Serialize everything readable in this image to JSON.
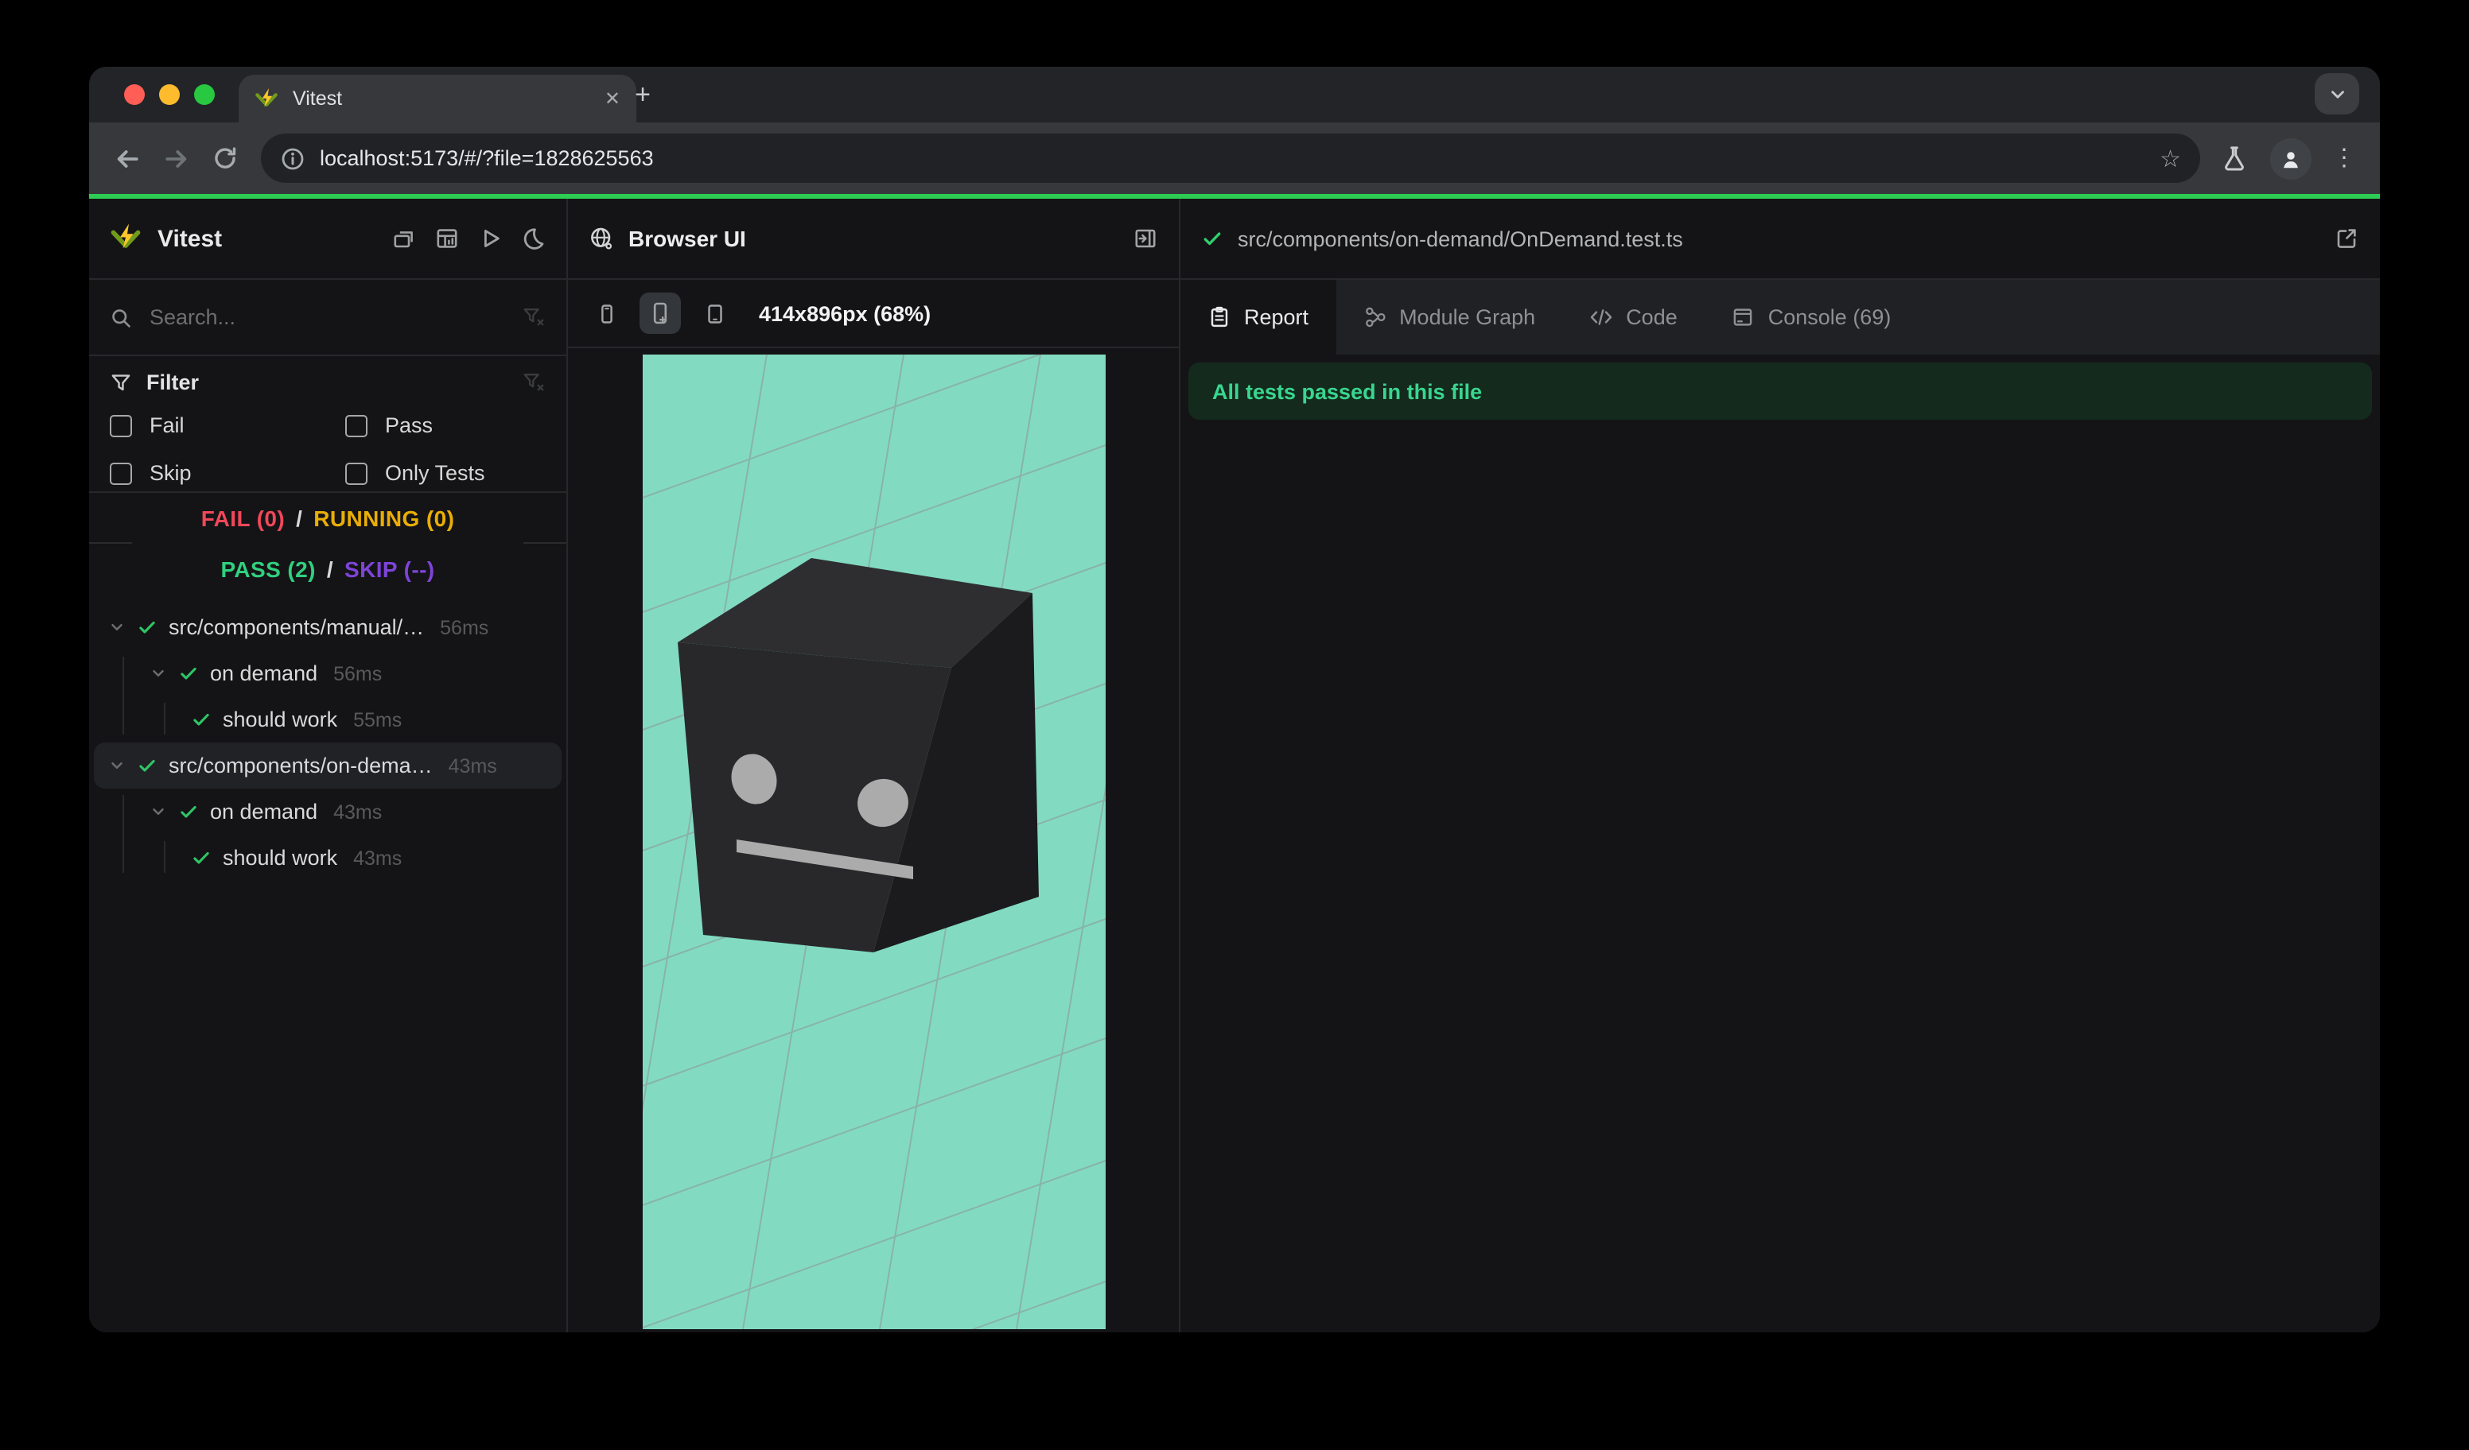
{
  "browser": {
    "tab_title": "Vitest",
    "url": "localhost:5173/#/?file=1828625563",
    "glyphs": {
      "close_tab": "✕",
      "new_tab": "+",
      "menu": "⋮",
      "bookmark": "☆"
    }
  },
  "sidebar": {
    "app_title": "Vitest",
    "search_placeholder": "Search...",
    "filter": {
      "title": "Filter",
      "options": [
        {
          "label": "Fail",
          "checked": false
        },
        {
          "label": "Pass",
          "checked": false
        },
        {
          "label": "Skip",
          "checked": false
        },
        {
          "label": "Only Tests",
          "checked": false
        }
      ]
    },
    "status": {
      "fail": "FAIL (0)",
      "running": "RUNNING (0)",
      "pass": "PASS (2)",
      "skip": "SKIP (--)",
      "separator": "/"
    },
    "tree": [
      {
        "label": "src/components/manual/…",
        "duration": "56ms",
        "level": 1,
        "state": "pass"
      },
      {
        "label": "on demand",
        "duration": "56ms",
        "level": 2,
        "state": "pass"
      },
      {
        "label": "should work",
        "duration": "55ms",
        "level": 3,
        "state": "pass"
      },
      {
        "label": "src/components/on-dema…",
        "duration": "43ms",
        "level": 1,
        "state": "pass",
        "selected": true
      },
      {
        "label": "on demand",
        "duration": "43ms",
        "level": 2,
        "state": "pass"
      },
      {
        "label": "should work",
        "duration": "43ms",
        "level": 3,
        "state": "pass"
      }
    ]
  },
  "preview": {
    "title": "Browser UI",
    "viewport_label": "414x896px (68%)"
  },
  "report": {
    "file_path": "src/components/on-demand/OnDemand.test.ts",
    "tabs": [
      {
        "label": "Report",
        "active": true
      },
      {
        "label": "Module Graph",
        "active": false
      },
      {
        "label": "Code",
        "active": false
      },
      {
        "label": "Console (69)",
        "active": false
      }
    ],
    "banner": "All tests passed in this file"
  },
  "colors": {
    "accent_green": "#2ecb55",
    "fail": "#f0485a",
    "running": "#e9ae06",
    "pass": "#30d07e",
    "skip": "#7e44d8",
    "viewport_bg": "#82dbc1",
    "banner_bg": "#142a1d",
    "banner_text": "#39d68f",
    "traffic_red": "#ff5e57",
    "traffic_yellow": "#febb2e",
    "traffic_green": "#28c841"
  }
}
